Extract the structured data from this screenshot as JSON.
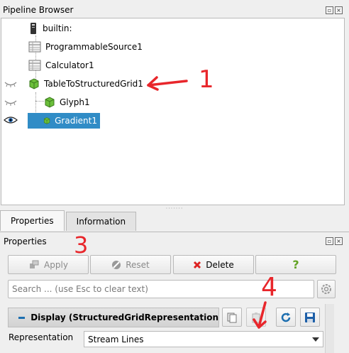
{
  "pipeline_browser": {
    "title": "Pipeline Browser",
    "items": [
      {
        "label": "builtin:",
        "icon": "server-icon",
        "visible": null
      },
      {
        "label": "ProgrammableSource1",
        "icon": "table-icon",
        "visible": null
      },
      {
        "label": "Calculator1",
        "icon": "table-icon",
        "visible": null
      },
      {
        "label": "TableToStructuredGrid1",
        "icon": "cube-icon",
        "visible": false
      },
      {
        "label": "Glyph1",
        "icon": "cube-icon",
        "visible": false
      },
      {
        "label": "Gradient1",
        "icon": "cube-icon",
        "visible": true,
        "selected": true
      }
    ]
  },
  "tabs": [
    {
      "label": "Properties",
      "active": true
    },
    {
      "label": "Information",
      "active": false
    }
  ],
  "properties": {
    "title": "Properties",
    "apply_label": "Apply",
    "reset_label": "Reset",
    "delete_label": "Delete",
    "help_label": "?",
    "search_placeholder": "Search ... (use Esc to clear text)",
    "section_title": "Display (StructuredGridRepresentation",
    "representation_label": "Representation",
    "representation_value": "Stream Lines"
  },
  "annotations": {
    "one": "1",
    "three": "3",
    "four": "4",
    "color": "#e8262b"
  }
}
